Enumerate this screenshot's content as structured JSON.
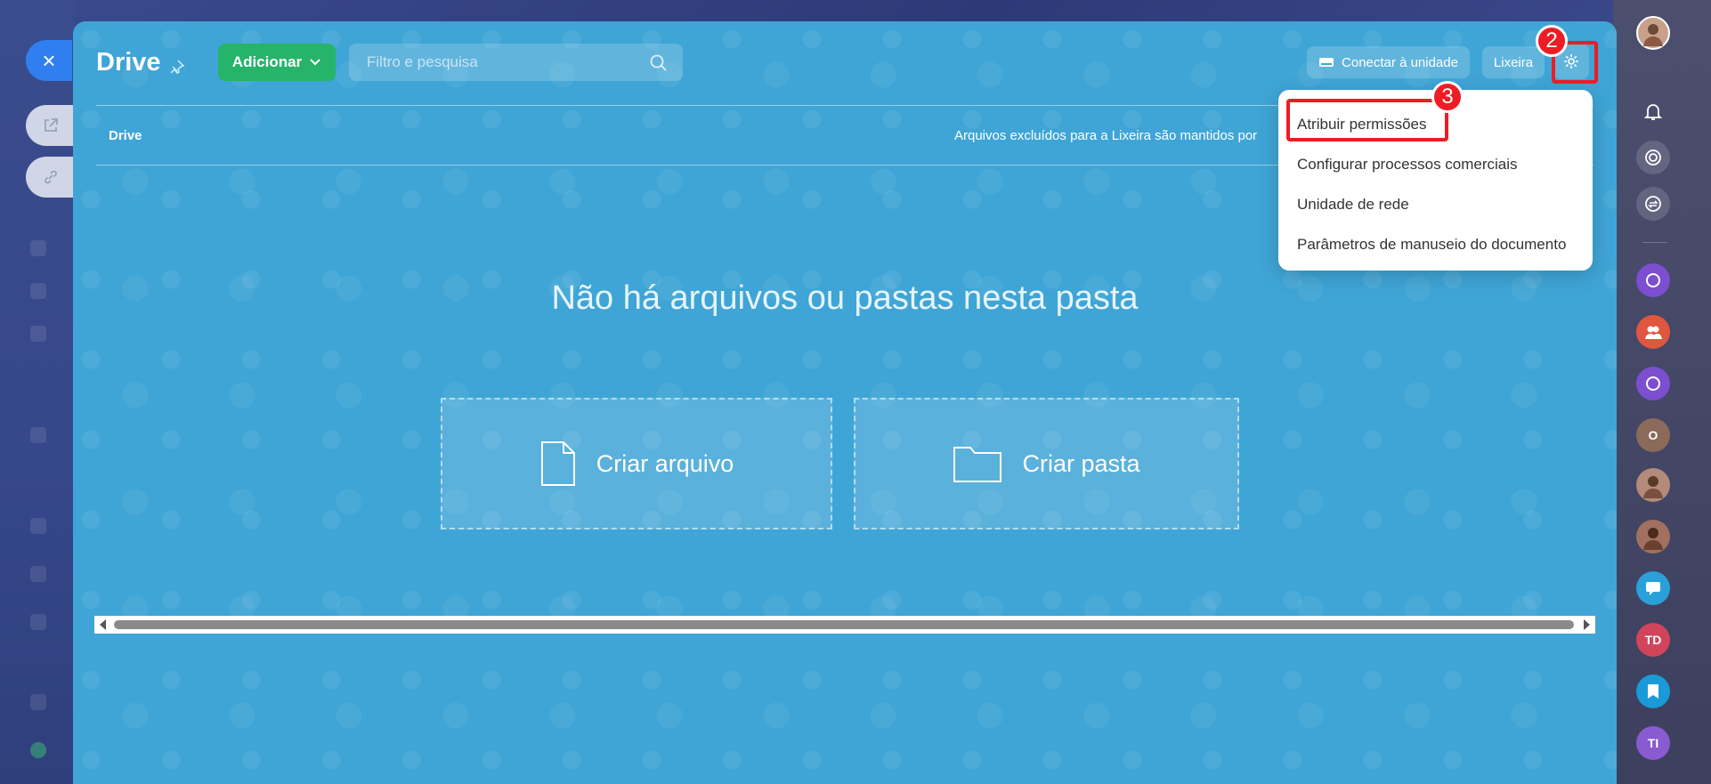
{
  "window": {
    "title": "Drive",
    "close_label": "×"
  },
  "toolbar": {
    "add_label": "Adicionar",
    "search_placeholder": "Filtro e pesquisa",
    "connect_drive_label": "Conectar à unidade",
    "trash_label": "Lixeira"
  },
  "breadcrumb": {
    "current": "Drive"
  },
  "notice": {
    "trash_retention": "Arquivos excluídos para a Lixeira são mantidos por"
  },
  "empty_state": {
    "message": "Não há arquivos ou pastas nesta pasta",
    "create_file_label": "Criar arquivo",
    "create_folder_label": "Criar pasta"
  },
  "settings_menu": {
    "items": [
      {
        "label": "Atribuir permissões"
      },
      {
        "label": "Configurar processos comerciais"
      },
      {
        "label": "Unidade de rede"
      },
      {
        "label": "Parâmetros de manuseio do documento"
      }
    ]
  },
  "annotations": {
    "step_settings": "2",
    "step_permissions": "3"
  },
  "right_rail": {
    "avatar_initials": [
      "O",
      "TD",
      "TI"
    ]
  },
  "colors": {
    "panel_bg": "#3fa5d6",
    "add_button": "#26b36a",
    "close_button": "#2f7ff0",
    "highlight_red": "#ee1c25"
  }
}
